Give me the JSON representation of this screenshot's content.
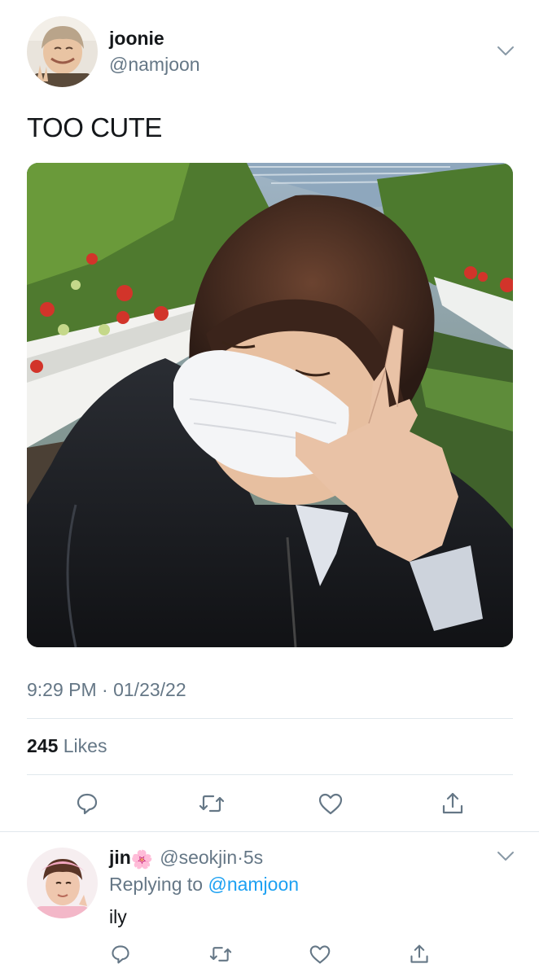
{
  "tweet": {
    "display_name": "joonie",
    "handle": "@namjoon",
    "text": "TOO CUTE",
    "timestamp": "9:29 PM · 01/23/22",
    "likes_count": "245",
    "likes_label": "Likes",
    "icons": [
      "reply-icon",
      "retweet-icon",
      "like-icon",
      "share-icon",
      "chevron-down-icon"
    ]
  },
  "reply": {
    "display_name": "jin",
    "emoji": "🌸",
    "handle": "@seokjin",
    "separator": "·",
    "time": "5s",
    "replying_prefix": "Replying to",
    "replying_to": "@namjoon",
    "text": "ily"
  },
  "colors": {
    "text": "#14171a",
    "secondary": "#657786",
    "link": "#1da1f2",
    "divider": "#e1e8ed"
  }
}
